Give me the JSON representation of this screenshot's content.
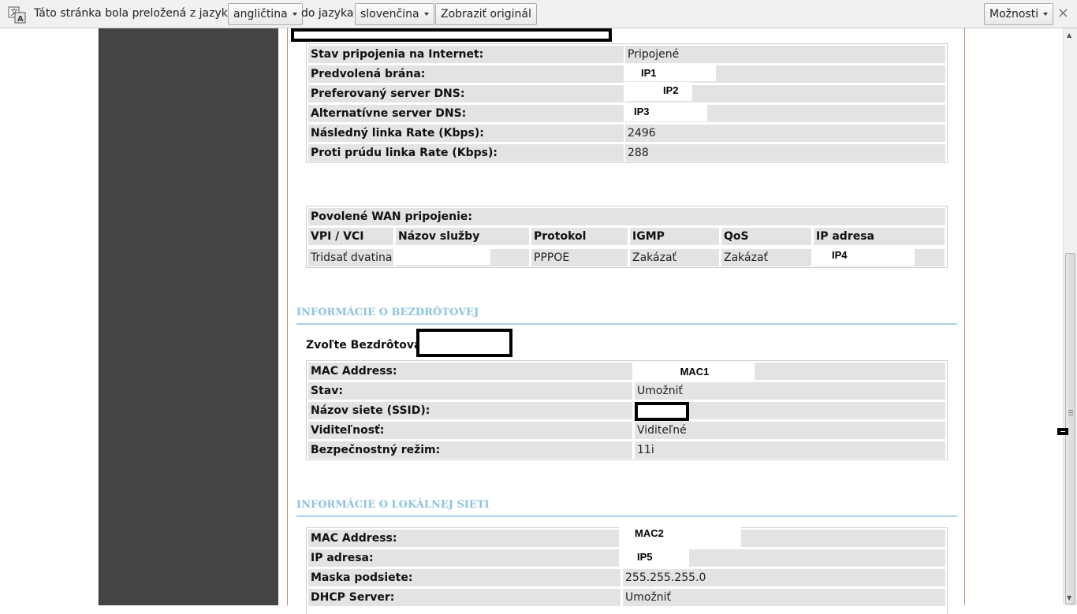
{
  "translate_bar": {
    "message": "Táto stránka bola preložená z jazyka",
    "from_lang": "angličtina",
    "to_label": "do jazyka",
    "to_lang": "slovenčina",
    "show_original": "Zobraziť originál",
    "options": "Možnosti",
    "close": "×"
  },
  "internet": {
    "rows": [
      {
        "label": "Stav pripojenia na Internet:",
        "value": "Pripojené"
      },
      {
        "label": "Predvolená brána:",
        "value": "IP1"
      },
      {
        "label": "Preferovaný server DNS:",
        "value": "IP2"
      },
      {
        "label": "Alternatívne server DNS:",
        "value": "IP3"
      },
      {
        "label": "Následný linka Rate (Kbps):",
        "value": "2496"
      },
      {
        "label": "Proti prúdu linka Rate (Kbps):",
        "value": "288"
      }
    ]
  },
  "wan": {
    "title": "Povolené WAN pripojenie:",
    "headers": [
      "VPI / VCI",
      "Názov služby",
      "Protokol",
      "IGMP",
      "QoS",
      "IP adresa"
    ],
    "row": [
      "Tridsať dvatina",
      "",
      "PPPOE",
      "Zakázať",
      "Zakázať",
      "IP4"
    ]
  },
  "wireless": {
    "section_title": "INFORMÁCIE O BEZDRÔTOVEJ",
    "select_label": "Zvoľte Bezdrôtová:",
    "rows": [
      {
        "label": "MAC Address:",
        "value": "MAC1"
      },
      {
        "label": "Stav:",
        "value": "Umožniť"
      },
      {
        "label": "Názov siete (SSID):",
        "value": ""
      },
      {
        "label": "Viditeľnosť:",
        "value": "Viditeľné"
      },
      {
        "label": "Bezpečnostný režim:",
        "value": "11i"
      }
    ]
  },
  "lan": {
    "section_title": "INFORMÁCIE O LOKÁLNEJ SIETI",
    "rows": [
      {
        "label": "MAC Address:",
        "value": "MAC2"
      },
      {
        "label": "IP adresa:",
        "value": "IP5"
      },
      {
        "label": "Maska podsiete:",
        "value": "255.255.255.0"
      },
      {
        "label": "DHCP Server:",
        "value": "Umožniť"
      }
    ]
  },
  "scrollbar": {
    "up": "▲",
    "down": "▼",
    "position": 0.6
  }
}
